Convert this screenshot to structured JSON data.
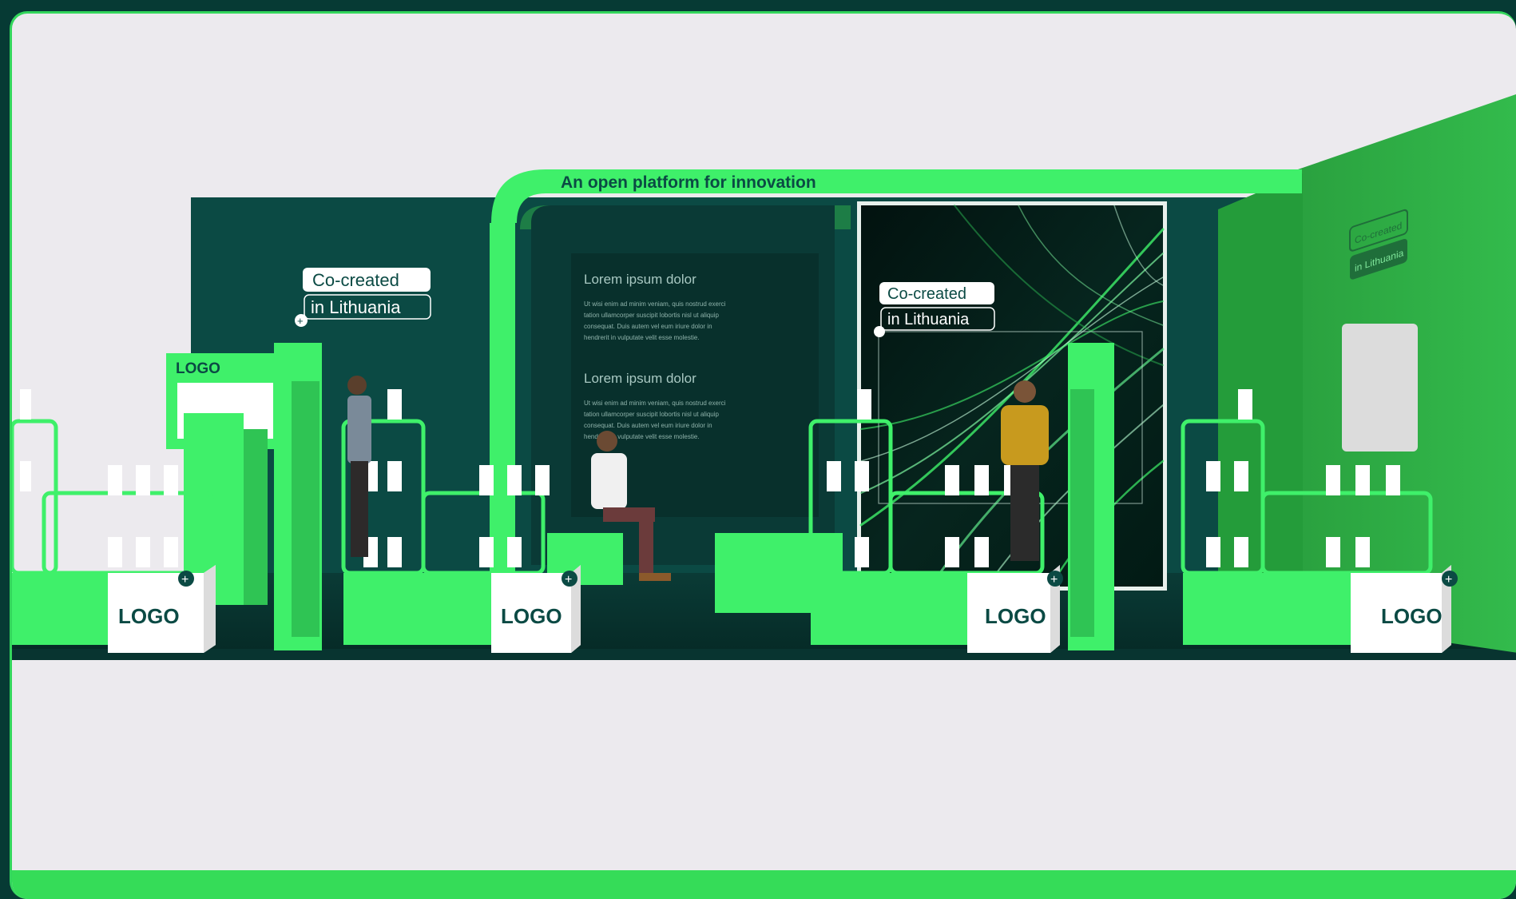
{
  "image": {
    "headline": "An open platform for innovation",
    "badge_left": {
      "line1": "Co-created",
      "line2": "in Lithuania"
    },
    "badge_center": {
      "line1": "Co-created",
      "line2": "in Lithuania"
    },
    "side_wall_badge": {
      "line1": "Co-created",
      "line2": "in Lithuania"
    },
    "panel_heading_1": "Lorem ipsum dolor",
    "panel_body_1": [
      "Ut wisi enim ad minim veniam, quis nostrud exerci",
      "tation ullamcorper suscipit lobortis nisl ut aliquip",
      "consequat. Duis autem vel eum iriure dolor in",
      "hendrerit in vulputate velit esse molestie."
    ],
    "panel_heading_2": "Lorem ipsum dolor",
    "panel_body_2": [
      "Ut wisi enim ad minim veniam, quis nostrud exerci",
      "tation ullamcorper suscipit lobortis nisl ut aliquip",
      "consequat. Duis autem vel eum iriure dolor in",
      "hendrerit in vulputate velit esse molestie."
    ],
    "logo_tower_label": "LOGO",
    "logo_cubes": [
      "LOGO",
      "LOGO",
      "LOGO",
      "LOGO"
    ],
    "colors": {
      "frame_bg": "#063a34",
      "canvas_bg": "#eceaee",
      "brand_green": "#35dc58",
      "dark_teal": "#0b4a44",
      "deep_teal": "#07332f",
      "bright_green": "#3ff06a",
      "side_green": "#2ea843"
    }
  }
}
